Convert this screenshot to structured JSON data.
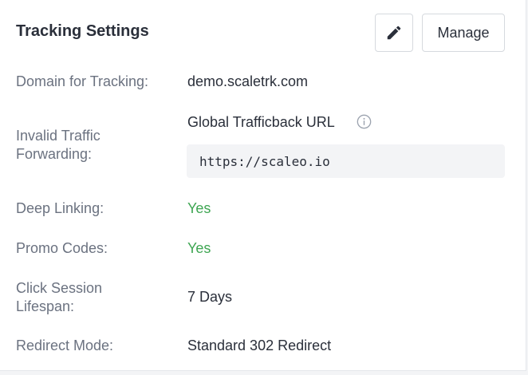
{
  "header": {
    "title": "Tracking Settings",
    "manage_label": "Manage",
    "edit_icon": "pencil-icon"
  },
  "settings": {
    "domain_label": "Domain for Tracking:",
    "domain_value": "demo.scaletrk.com",
    "invalid_label_line1": "Invalid Traffic",
    "invalid_label_line2": "Forwarding:",
    "trafficback_title": "Global Trafficback URL",
    "trafficback_info_icon": "info-icon",
    "trafficback_url": "https://scaleo.io",
    "deep_linking_label": "Deep Linking:",
    "deep_linking_value": "Yes",
    "promo_codes_label": "Promo Codes:",
    "promo_codes_value": "Yes",
    "session_label_line1": "Click Session",
    "session_label_line2": "Lifespan:",
    "session_value": "7 Days",
    "redirect_label": "Redirect Mode:",
    "redirect_value": "Standard 302 Redirect"
  },
  "colors": {
    "text": "#2a2f3a",
    "label": "#6b7280",
    "success": "#3fa653",
    "code_bg": "#f3f4f6"
  }
}
